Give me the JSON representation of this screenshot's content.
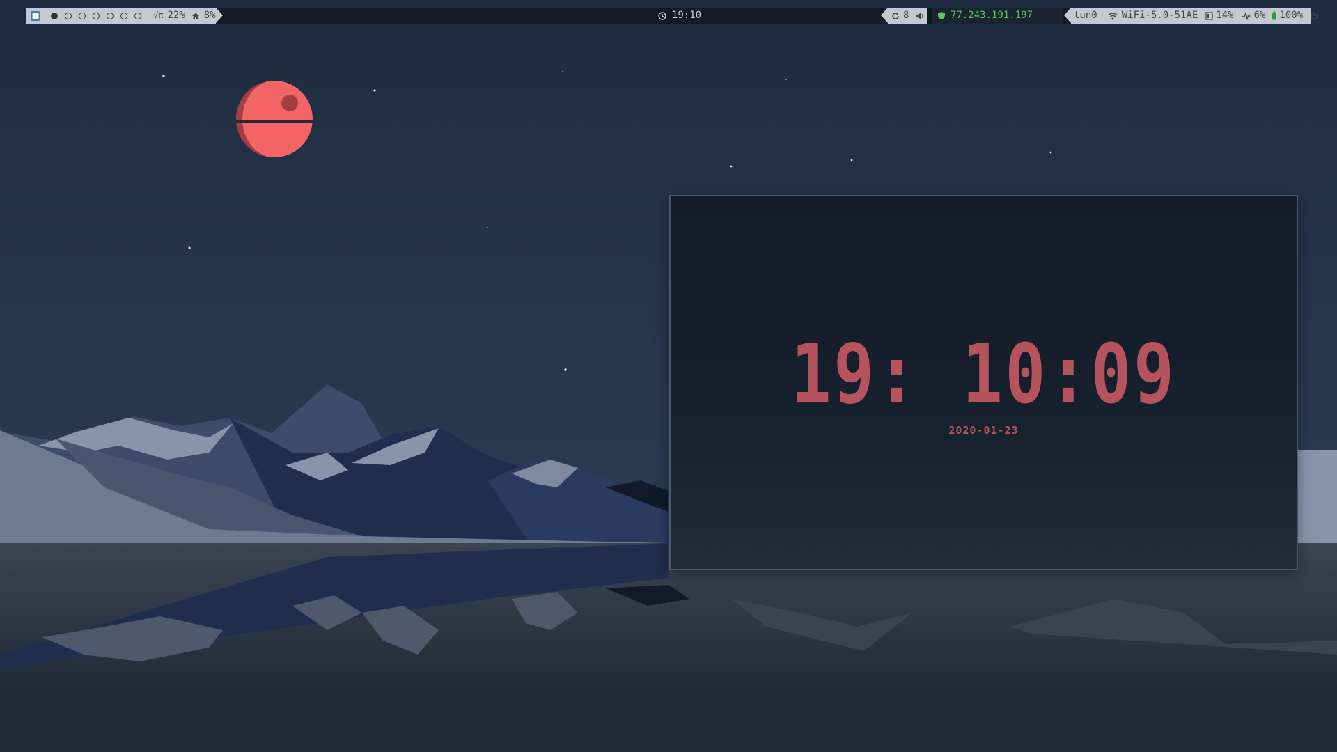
{
  "bar": {
    "workspaces": [
      {
        "name": "1",
        "active": true
      },
      {
        "name": "2",
        "active": false
      },
      {
        "name": "3",
        "active": false
      },
      {
        "name": "4",
        "active": false
      },
      {
        "name": "5",
        "active": false
      },
      {
        "name": "6",
        "active": false
      },
      {
        "name": "7",
        "active": false
      }
    ],
    "root_usage": "22%",
    "home_usage": "8%",
    "center_time": "19:10",
    "updates": "8",
    "vpn_ip": "77.243.191.197",
    "vpn_interface": "tun0",
    "wifi_ssid": "WiFi-5.0-51AE",
    "memory": "14%",
    "cpu": "6%",
    "battery": "100%",
    "colors": {
      "bar_bg": "#111a25",
      "vpn_green": "#4ecb5a"
    }
  },
  "clock": {
    "time": "19: 10:09",
    "date": "2020-01-23",
    "color": "#b5545d"
  },
  "wallpaper": {
    "moon_color": "#f26466"
  }
}
